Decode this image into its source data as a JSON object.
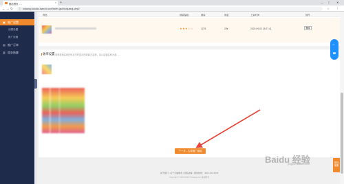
{
  "browser": {
    "tab_title": "推店首页 - ...",
    "tab_close": "×",
    "new_tab": "+",
    "url": "tuiwang.youdao.tuanxin.com/index.jsp#/tuiguang-step2",
    "win_min": "—",
    "win_max": "□",
    "win_close": "✕"
  },
  "sidebar": {
    "items": [
      {
        "icon": "▣",
        "label": "推广设置",
        "active": true
      },
      {
        "icon": "▤",
        "label": "推广订单",
        "active": false
      },
      {
        "icon": "▥",
        "label": "佣金结算",
        "active": false
      }
    ],
    "subitems": [
      "创建设置",
      "推广设置"
    ]
  },
  "table": {
    "headers": [
      "商品",
      "销量星级",
      "销量",
      "佣金",
      "上架时间",
      "操作"
    ],
    "row": {
      "stars": "★★★☆☆",
      "sales": "1275",
      "commission": "29¥",
      "time": "2020-09-02 18:27:41",
      "op": "删除"
    }
  },
  "section": {
    "title": "收率设置",
    "hint": "收率是指买家扫码支付时显示的收款方名称，请以店铺名称为准……"
  },
  "next_button": "下一步，生成推广链接",
  "footer": {
    "links": "关于我们 | 关于天猫服务 | 隐私政策 | 服务热线：400-1234-5678",
    "copyright": "Copyright © 2004-2020 Tuiwang.com 版权所有"
  },
  "floating": {
    "top": "⌂",
    "bottom": "☎"
  },
  "side_orange": "在线客服",
  "watermark": {
    "main": "Baidu 经验",
    "sub": "jingyan.baidu.com"
  },
  "colors": {
    "accent": "#f08a2c",
    "sidebar": "#1f2b4a",
    "float": "#1e90ff"
  }
}
